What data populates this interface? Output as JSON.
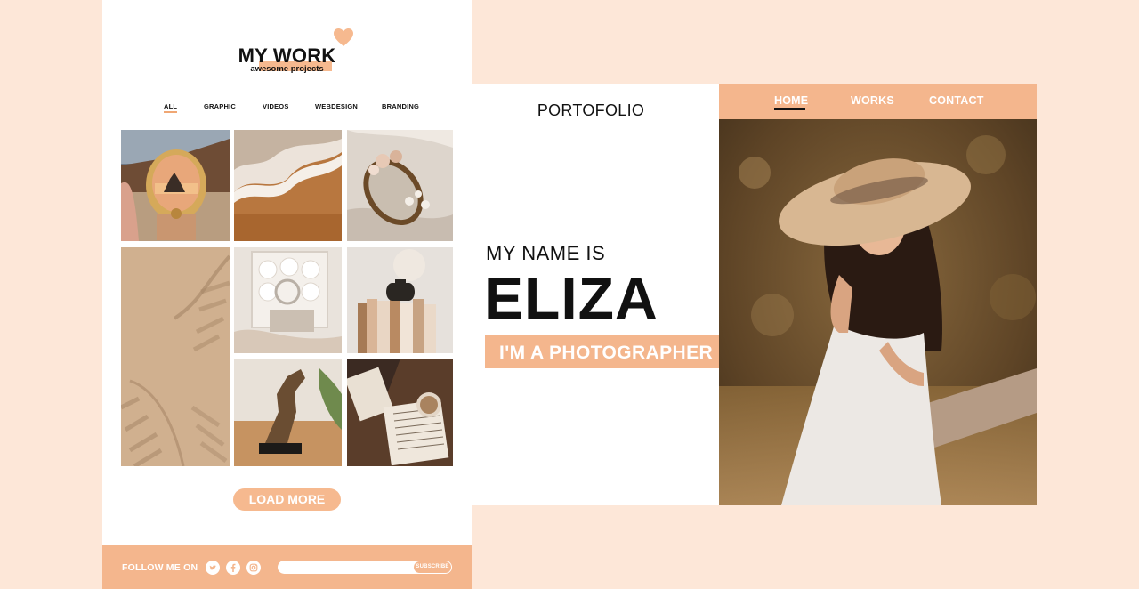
{
  "mywork": {
    "title": "MY WORK",
    "subtitle": "awesome projects",
    "filters": [
      "ALL",
      "GRAPHIC",
      "VIDEOS",
      "WEBDESIGN",
      "BRANDING"
    ],
    "active_filter": "ALL",
    "load_more": "LOAD MORE",
    "footer": {
      "follow": "FOLLOW ME ON",
      "social_icons": [
        "twitter-icon",
        "facebook-icon",
        "instagram-icon"
      ],
      "subscribe": "SUBSCRIBE"
    }
  },
  "portfolio": {
    "brand": "PORTOFOLIO",
    "nav": [
      "HOME",
      "WORKS",
      "CONTACT"
    ],
    "active_nav": "HOME",
    "intro": "MY NAME IS",
    "name": "ELIZA",
    "role": "I'M A PHOTOGRAPHER"
  },
  "colors": {
    "background": "#fde7d8",
    "accent": "#f4b68d",
    "text": "#111111"
  }
}
